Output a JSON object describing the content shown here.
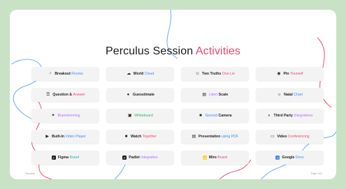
{
  "title": {
    "main": "Perculus Session ",
    "accent": "Activities"
  },
  "footer": {
    "logo": "Perculus",
    "note": "Page 1/23"
  },
  "colors": {
    "background": "#c9e2c6",
    "card": "#ffffff",
    "accent_pink": "#f0486a",
    "accent_blue": "#3d8bff",
    "tile": "#f3f3f4"
  },
  "activities": [
    {
      "icon": "breakout-rooms-icon",
      "glyph": "♂",
      "a": "Breakout ",
      "b": "Rooms",
      "hl": "blue"
    },
    {
      "icon": "world-cloud-icon",
      "glyph": "☁",
      "a": "World ",
      "b": "Cloud",
      "hl": "blue"
    },
    {
      "icon": "two-truths-icon",
      "glyph": "☺",
      "a": "Two Truths ",
      "b": "One Lie",
      "hl": "red"
    },
    {
      "icon": "pin-icon",
      "glyph": "◉",
      "a": "Pin ",
      "b": "Yourself",
      "hl": "red"
    },
    {
      "icon": "question-answer-icon",
      "glyph": "☰",
      "a": "Question & ",
      "b": "Answer",
      "hl": "red"
    },
    {
      "icon": "guesstimate-icon",
      "glyph": "●",
      "a": "Guesstimate",
      "b": "",
      "hl": "none"
    },
    {
      "icon": "likert-scale-icon",
      "glyph": "▤",
      "a": "",
      "b": "Likert",
      "c": " Scale",
      "hl": "purple"
    },
    {
      "icon": "natal-chart-icon",
      "glyph": "☼",
      "a": "Natal ",
      "b": "Chart",
      "hl": "blue"
    },
    {
      "icon": "brainstorming-icon",
      "glyph": "✦",
      "a": "",
      "b": "Brainstorming",
      "hl": "purple"
    },
    {
      "icon": "whiteboard-icon",
      "glyph": "▣",
      "a": "",
      "b": "Whiteboard",
      "hl": "green"
    },
    {
      "icon": "second-camera-icon",
      "glyph": "■",
      "a": "",
      "b": "Second",
      "c": " Camera",
      "hl": "blue"
    },
    {
      "icon": "third-party-icon",
      "glyph": "⌕",
      "a": "Third Party ",
      "b": "Integrations",
      "hl": "purple"
    },
    {
      "icon": "video-player-icon",
      "glyph": "▶",
      "a": "Built-In ",
      "b": "Video Player",
      "hl": "blue"
    },
    {
      "icon": "watch-together-icon",
      "glyph": "■",
      "a": "Watch ",
      "b": "Together",
      "hl": "red"
    },
    {
      "icon": "presentation-pdf-icon",
      "glyph": "▤",
      "a": "Presentation ",
      "b": "using PDF",
      "hl": "blue"
    },
    {
      "icon": "video-conferencing-icon",
      "glyph": "▭",
      "a": "Video ",
      "b": "Conferencing",
      "hl": "red"
    },
    {
      "icon": "figma-logo-icon",
      "glyph": "F",
      "a": "Figma ",
      "b": "Board",
      "hl": "teal",
      "sq": "#1e1e1e"
    },
    {
      "icon": "padlet-logo-icon",
      "glyph": "P",
      "a": "Padlet ",
      "b": "Integration",
      "hl": "purple",
      "sq": "#1e1e1e"
    },
    {
      "icon": "miro-logo-icon",
      "glyph": "M",
      "a": "Miro ",
      "b": "Board",
      "hl": "red",
      "sq": "#ffd02f"
    },
    {
      "icon": "google-docs-logo-icon",
      "glyph": "≡",
      "a": "Google ",
      "b": "Docs",
      "hl": "blue",
      "sq": "#3d8bff"
    }
  ]
}
